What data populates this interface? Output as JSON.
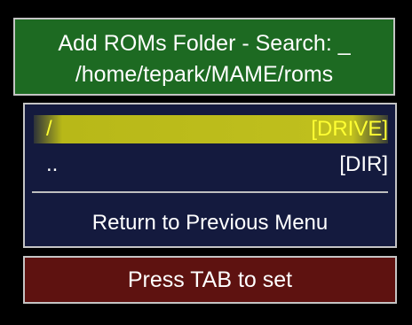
{
  "header": {
    "title": "Add ROMs Folder - Search: _",
    "path": "/home/tepark/MAME/roms"
  },
  "menu": {
    "items": [
      {
        "name": "/",
        "type": "[DRIVE]",
        "selected": true
      },
      {
        "name": "..",
        "type": "[DIR]",
        "selected": false
      }
    ],
    "return_label": "Return to Previous Menu"
  },
  "footer": {
    "hint": "Press TAB to set"
  },
  "colors": {
    "header_bg": "#1d6a22",
    "menu_bg": "#141a3e",
    "footer_bg": "#5e1210",
    "selected_text": "#ffff33",
    "selected_bg": "#c0c01e",
    "border": "#c4c4c4"
  }
}
